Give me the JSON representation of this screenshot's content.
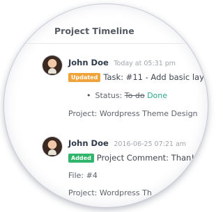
{
  "panel": {
    "title": "Project Timeline"
  },
  "timeline": {
    "entries": [
      {
        "author": "John Doe",
        "time": "Today at 05:31 pm",
        "badge": "Updated",
        "text": "Task: #11 - Add basic lay",
        "status_prefix": "Status:",
        "status_old": "To do",
        "status_new": "Done",
        "project": "Project: Wordpress Theme Design"
      },
      {
        "author": "John Doe",
        "time": "2016-06-25 07:21 am",
        "badge": "Added",
        "text": "Project Comment: Than!",
        "file": "File: #4",
        "project": "Project: Wordpress Th"
      }
    ]
  },
  "colors": {
    "updated_badge": "#f0a33a",
    "added_badge": "#31b46b",
    "done_status": "#2aa58a"
  }
}
